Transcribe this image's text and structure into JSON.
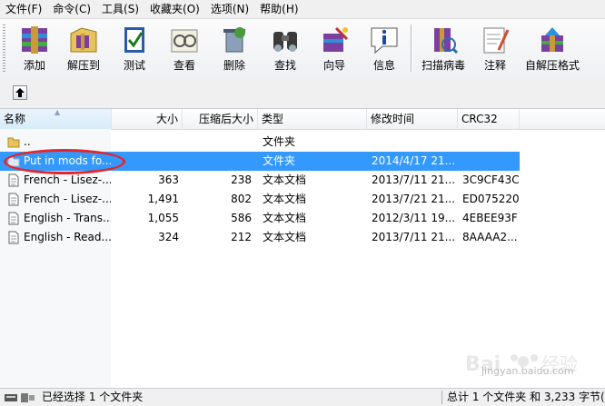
{
  "menu": [
    "文件(F)",
    "命令(C)",
    "工具(S)",
    "收藏夹(O)",
    "选项(N)",
    "帮助(H)"
  ],
  "toolbar": {
    "group1": [
      {
        "label": "添加",
        "icon": "add-archive-icon"
      },
      {
        "label": "解压到",
        "icon": "extract-to-icon"
      },
      {
        "label": "测试",
        "icon": "test-icon"
      },
      {
        "label": "查看",
        "icon": "view-icon"
      },
      {
        "label": "删除",
        "icon": "delete-icon"
      },
      {
        "label": "查找",
        "icon": "find-icon"
      },
      {
        "label": "向导",
        "icon": "wizard-icon"
      },
      {
        "label": "信息",
        "icon": "info-icon"
      }
    ],
    "group2": [
      {
        "label": "扫描病毒",
        "icon": "virus-scan-icon"
      },
      {
        "label": "注释",
        "icon": "comment-icon"
      },
      {
        "label": "自解压格式",
        "icon": "sfx-icon"
      }
    ]
  },
  "address": {
    "up_icon": "up-folder-icon"
  },
  "columns": [
    "名称",
    "大小",
    "压缩后大小",
    "类型",
    "修改时间",
    "CRC32"
  ],
  "rows": [
    {
      "name": "..",
      "size": "",
      "packed": "",
      "type": "文件夹",
      "modified": "",
      "crc": "",
      "icon": "folder-icon"
    },
    {
      "name": "Put in mods fo...",
      "size": "",
      "packed": "",
      "type": "文件夹",
      "modified": "2014/4/17 21...",
      "crc": "",
      "icon": "folder-icon",
      "selected": true
    },
    {
      "name": "French - Lisez-...",
      "size": "363",
      "packed": "238",
      "type": "文本文档",
      "modified": "2013/7/11 21...",
      "crc": "3C9CF43C",
      "icon": "text-file-icon"
    },
    {
      "name": "French - Lisez-...",
      "size": "1,491",
      "packed": "802",
      "type": "文本文档",
      "modified": "2013/7/21 21...",
      "crc": "ED075220",
      "icon": "text-file-icon"
    },
    {
      "name": "English - Trans...",
      "size": "1,055",
      "packed": "586",
      "type": "文本文档",
      "modified": "2012/3/11 19...",
      "crc": "4EBEE93F",
      "icon": "text-file-icon"
    },
    {
      "name": "English - Read...",
      "size": "324",
      "packed": "212",
      "type": "文本文档",
      "modified": "2013/7/11 21...",
      "crc": "8AAAA2...",
      "icon": "text-file-icon"
    }
  ],
  "status": {
    "left": "已经选择 1 个文件夹",
    "right": "总计 1 个文件夹 和 3,233 字节(4"
  },
  "watermark": "jingyan.baidu.com",
  "colors": {
    "selection": "#3399ff",
    "highlight_circle": "#e3262b"
  }
}
